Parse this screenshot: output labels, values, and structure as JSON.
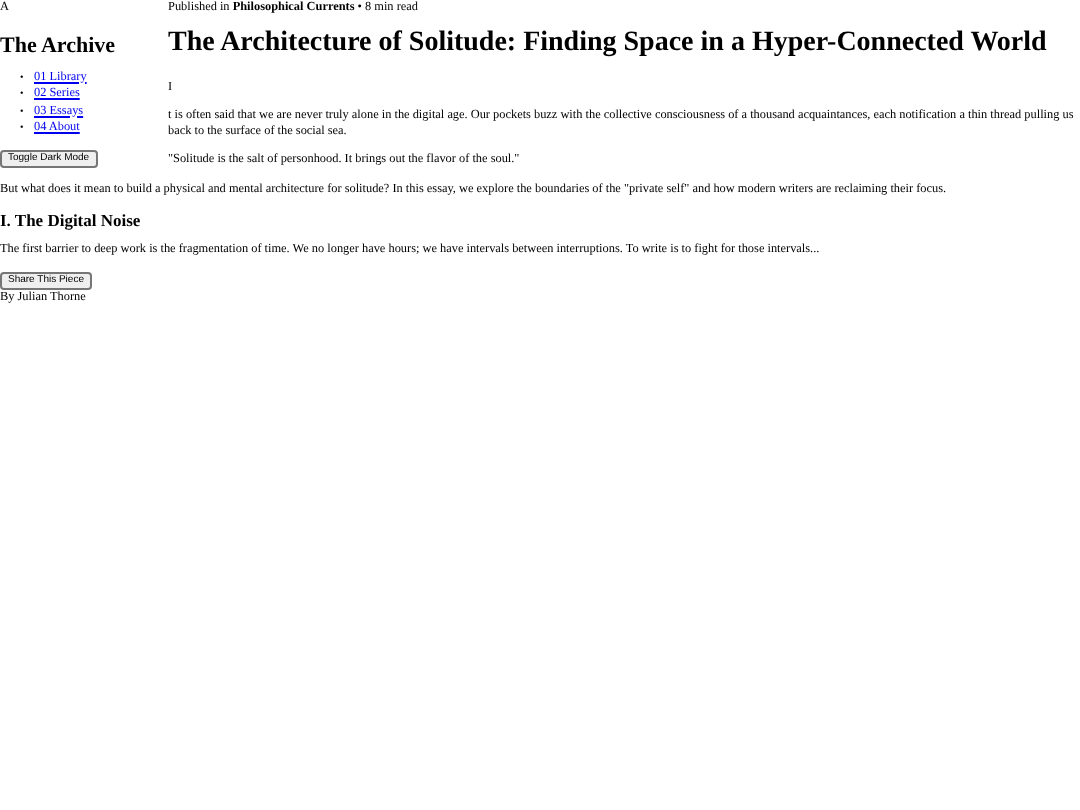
{
  "sidebar": {
    "logo": "A",
    "title": "The Archive",
    "nav": [
      {
        "bullet": "•",
        "label": "01 Library"
      },
      {
        "bullet": "•",
        "label": "02 Series"
      },
      {
        "bullet": "•",
        "label": "03 Essays"
      },
      {
        "bullet": "•",
        "label": "04 About"
      }
    ],
    "toggle_button": "Toggle Dark Mode"
  },
  "article": {
    "meta": "Published in **Philosophical Currents** • 8 min read",
    "title": "The Architecture of Solitude: Finding Space in a Hyper-Connected World",
    "drop_cap": "I",
    "intro": "t is often said that we are never truly alone in the digital age. Our pockets buzz with the collective consciousness of a thousand acquaintances, each notification a thin thread pulling us back to the surface of the social sea.",
    "quote": "\"Solitude is the salt of personhood. It brings out the flavor of the soul.\"",
    "paragraph": "But what does it mean to build a physical and mental architecture for solitude? In this essay, we explore the boundaries of the \"private self\" and how modern writers are reclaiming their focus.",
    "section_heading": "I. The Digital Noise",
    "section_text": "The first barrier to deep work is the fragmentation of time. We no longer have hours; we have intervals between interruptions. To write is to fight for those intervals...",
    "share_button": "Share This Piece",
    "byline": "By Julian Thorne"
  }
}
